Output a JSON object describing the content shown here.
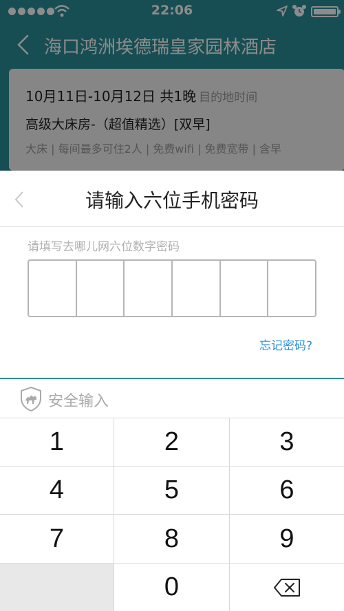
{
  "status_bar": {
    "time": "22:06"
  },
  "nav": {
    "title": "海口鸿洲埃德瑞皇家园林酒店"
  },
  "booking_card": {
    "dates": "10月11日-10月12日 共1晚",
    "dates_hint": "目的地时间",
    "room": "高级大床房-（超值精选）[双早]",
    "features": "大床 | 每间最多可住2人 | 免费wifi | 免费宽带 | 含早"
  },
  "sheet": {
    "title": "请输入六位手机密码",
    "hint": "请填写去哪儿网六位数字密码",
    "forgot_label": "忘记密码?",
    "secure_label": "安全输入"
  },
  "keypad": {
    "k1": "1",
    "k2": "2",
    "k3": "3",
    "k4": "4",
    "k5": "5",
    "k6": "6",
    "k7": "7",
    "k8": "8",
    "k9": "9",
    "k0": "0"
  },
  "colors": {
    "accent": "#2b8e98",
    "link": "#2a8fd8"
  }
}
